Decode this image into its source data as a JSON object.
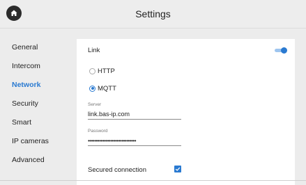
{
  "header": {
    "title": "Settings",
    "home_icon": "home-icon"
  },
  "sidebar": {
    "items": [
      {
        "label": "General",
        "active": false
      },
      {
        "label": "Intercom",
        "active": false
      },
      {
        "label": "Network",
        "active": true
      },
      {
        "label": "Security",
        "active": false
      },
      {
        "label": "Smart",
        "active": false
      },
      {
        "label": "IP cameras",
        "active": false
      },
      {
        "label": "Advanced",
        "active": false
      }
    ]
  },
  "panel": {
    "link": {
      "label": "Link",
      "enabled": true
    },
    "protocols": [
      {
        "label": "HTTP",
        "selected": false
      },
      {
        "label": "MQTT",
        "selected": true
      }
    ],
    "server": {
      "label": "Server",
      "value": "link.bas-ip.com"
    },
    "password": {
      "label": "Password",
      "value": "••••••••••••••••••••••••••••••"
    },
    "secured": {
      "label": "Secured connection",
      "checked": true
    }
  },
  "colors": {
    "accent": "#2a7ad1",
    "background": "#ececec",
    "panel": "#ffffff"
  }
}
